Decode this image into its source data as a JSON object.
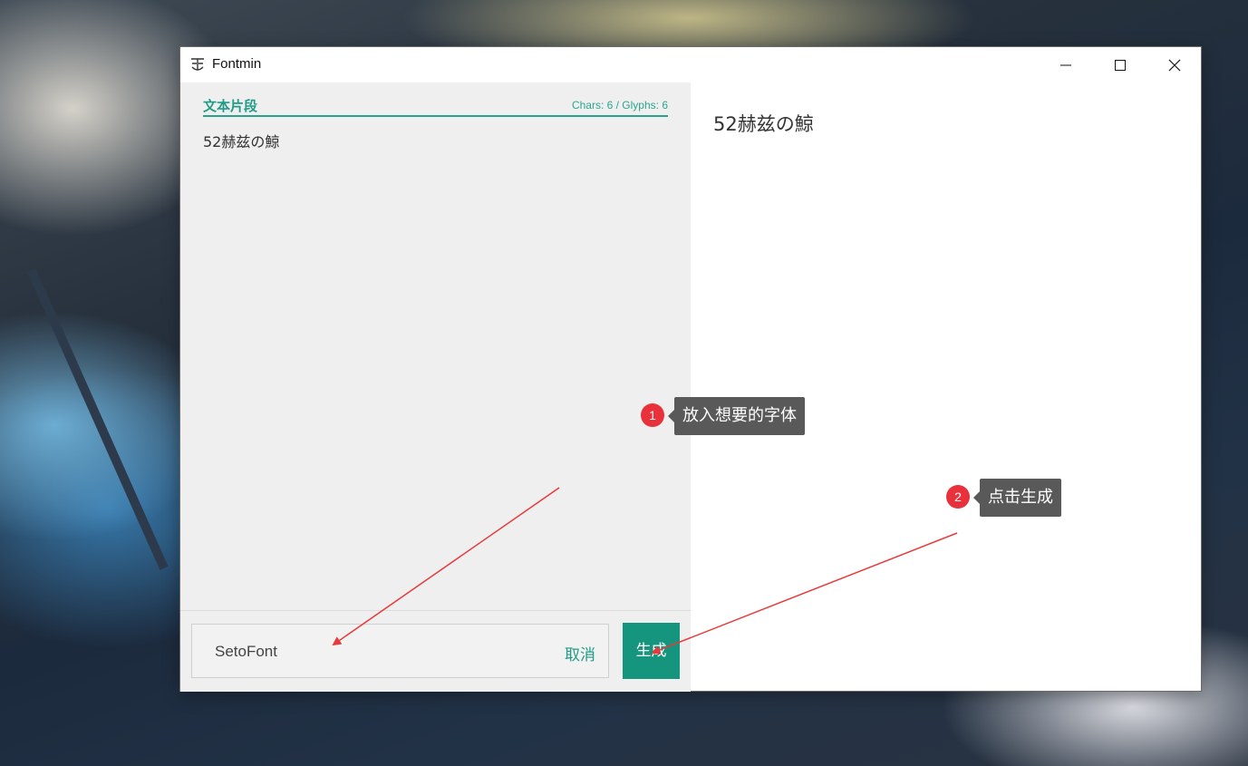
{
  "window": {
    "title": "Fontmin",
    "controls": [
      "minimize-icon",
      "maximize-icon",
      "close-icon"
    ]
  },
  "left_panel": {
    "section_title": "文本片段",
    "counts": "Chars: 6 / Glyphs: 6",
    "text": "52赫兹の鯨"
  },
  "bottom_bar": {
    "font_name": "SetoFont",
    "cancel_label": "取消",
    "generate_label": "生成"
  },
  "preview": {
    "text": "52赫兹の鯨"
  },
  "annotations": [
    {
      "number": "1",
      "label": "放入想要的字体"
    },
    {
      "number": "2",
      "label": "点击生成"
    }
  ],
  "colors": {
    "accent": "#1f9c86",
    "button": "#15957d",
    "annotation_badge": "#e8313a",
    "annotation_tip": "#595959",
    "arrow": "#e83a3a"
  }
}
